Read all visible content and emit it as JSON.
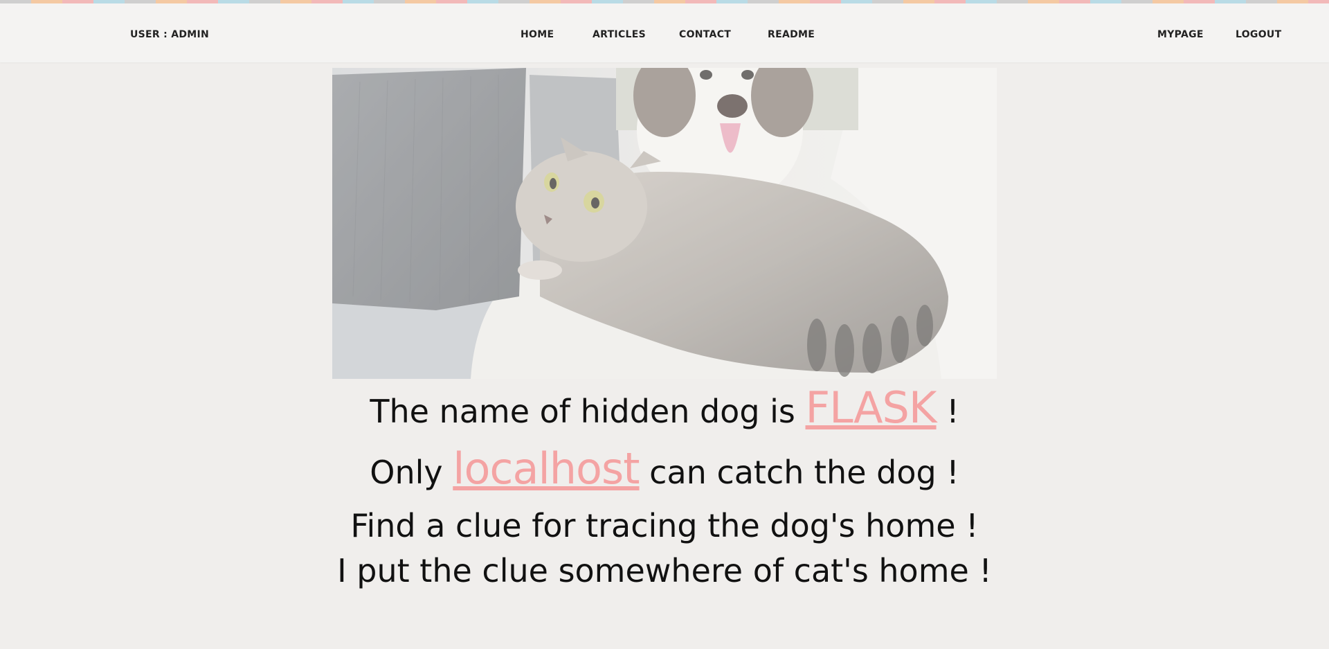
{
  "nav": {
    "user_label": "USER : ADMIN",
    "items": [
      {
        "label": "HOME"
      },
      {
        "label": "ARTICLES"
      },
      {
        "label": "CONTACT"
      },
      {
        "label": "README"
      }
    ],
    "right": [
      {
        "label": "MYPAGE"
      },
      {
        "label": "LOGOUT"
      }
    ]
  },
  "hero": {
    "image_subject": "cat-and-dog-photo"
  },
  "messages": {
    "line1_prefix": "The name of hidden dog is ",
    "line1_link": "FLASK",
    "line1_suffix": " !",
    "line2_prefix": "Only ",
    "line2_link": "localhost",
    "line2_suffix": " can catch the dog !",
    "line3": "Find a clue for tracing the dog's home !",
    "line4": "I put the clue somewhere of cat's home !"
  },
  "colors": {
    "background": "#f0eeec",
    "navbar": "#f4f3f2",
    "link_pink": "#f4a3a3",
    "text": "#111111"
  }
}
